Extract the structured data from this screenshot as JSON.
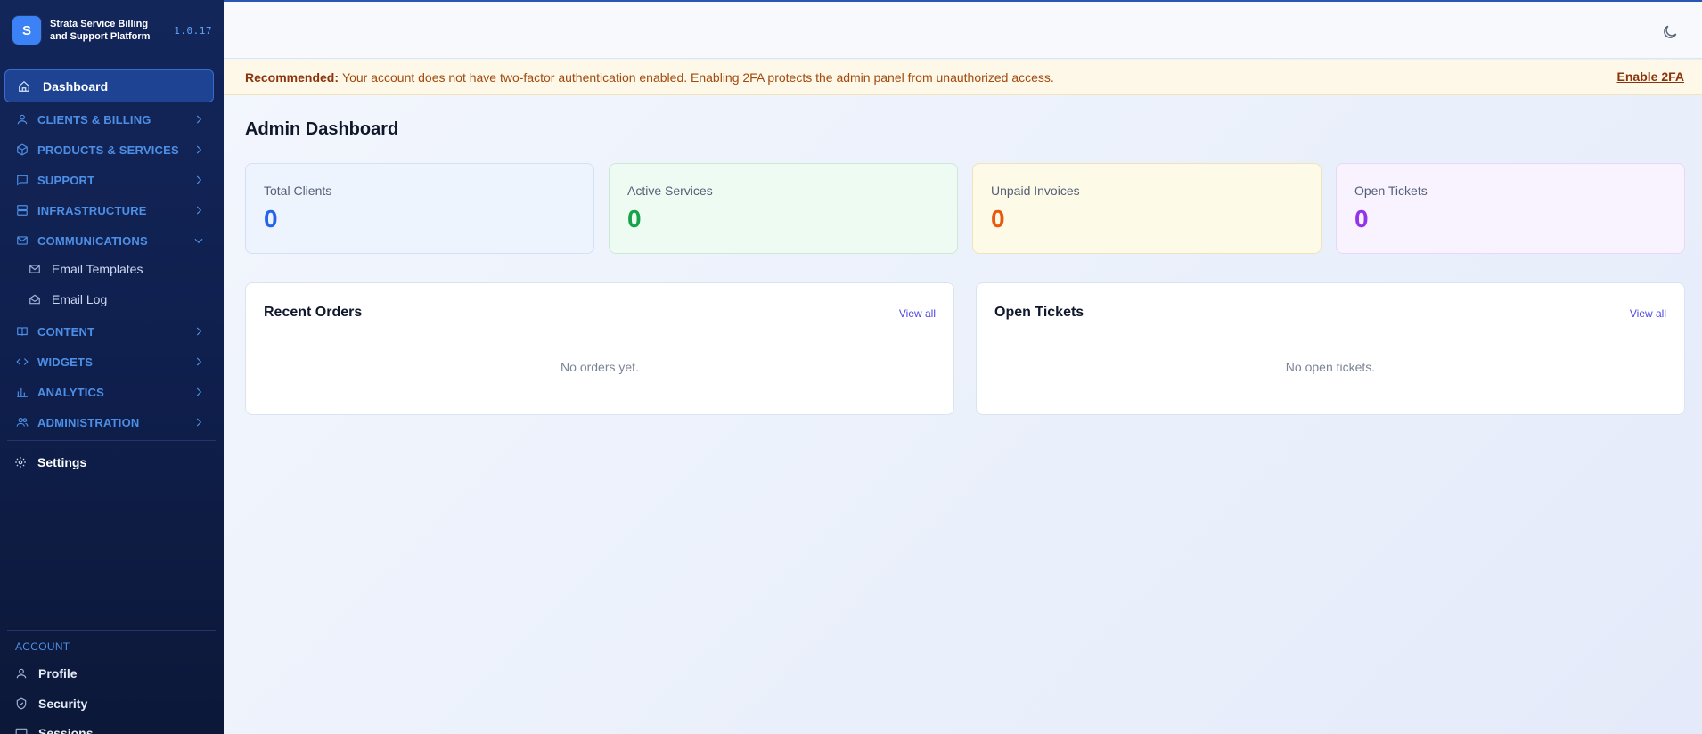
{
  "brand": {
    "logo_letter": "S",
    "name": "Strata Service Billing and Support Platform",
    "version": "1.0.17"
  },
  "sidebar": {
    "active_item": {
      "label": "Dashboard",
      "icon": "home-icon"
    },
    "groups": [
      {
        "label": "CLIENTS & BILLING",
        "icon": "users-icon",
        "expanded": false
      },
      {
        "label": "PRODUCTS & SERVICES",
        "icon": "package-icon",
        "expanded": false
      },
      {
        "label": "SUPPORT",
        "icon": "message-square-icon",
        "expanded": false
      },
      {
        "label": "INFRASTRUCTURE",
        "icon": "server-icon",
        "expanded": false
      },
      {
        "label": "COMMUNICATIONS",
        "icon": "mail-icon",
        "expanded": true
      },
      {
        "label": "CONTENT",
        "icon": "book-icon",
        "expanded": false
      },
      {
        "label": "WIDGETS",
        "icon": "code-icon",
        "expanded": false
      },
      {
        "label": "ANALYTICS",
        "icon": "bar-chart-icon",
        "expanded": false
      },
      {
        "label": "ADMINISTRATION",
        "icon": "user-group-icon",
        "expanded": false
      }
    ],
    "communications_items": [
      {
        "label": "Email Templates",
        "icon": "mail-icon"
      },
      {
        "label": "Email Log",
        "icon": "mail-open-icon"
      }
    ],
    "settings": {
      "label": "Settings",
      "icon": "gear-icon"
    },
    "account": {
      "title": "ACCOUNT",
      "items": [
        {
          "label": "Profile",
          "icon": "user-icon"
        },
        {
          "label": "Security",
          "icon": "shield-icon"
        },
        {
          "label": "Sessions",
          "icon": "monitor-icon"
        }
      ]
    }
  },
  "header": {
    "theme_toggle_icon": "moon-icon"
  },
  "banner": {
    "strong": "Recommended:",
    "text": "Your account does not have two-factor authentication enabled. Enabling 2FA protects the admin panel from unauthorized access.",
    "link": "Enable 2FA"
  },
  "page": {
    "title": "Admin Dashboard"
  },
  "stats": [
    {
      "label": "Total Clients",
      "value": "0",
      "color": "#2563eb",
      "bg": "#eef4fd"
    },
    {
      "label": "Active Services",
      "value": "0",
      "color": "#16a34a",
      "bg": "#eefbf2"
    },
    {
      "label": "Unpaid Invoices",
      "value": "0",
      "color": "#ea580c",
      "bg": "#fefae8"
    },
    {
      "label": "Open Tickets",
      "value": "0",
      "color": "#9333ea",
      "bg": "#f8f3fe"
    }
  ],
  "cards": [
    {
      "title": "Recent Orders",
      "view_all": "View all",
      "empty": "No orders yet."
    },
    {
      "title": "Open Tickets",
      "view_all": "View all",
      "empty": "No open tickets."
    }
  ]
}
